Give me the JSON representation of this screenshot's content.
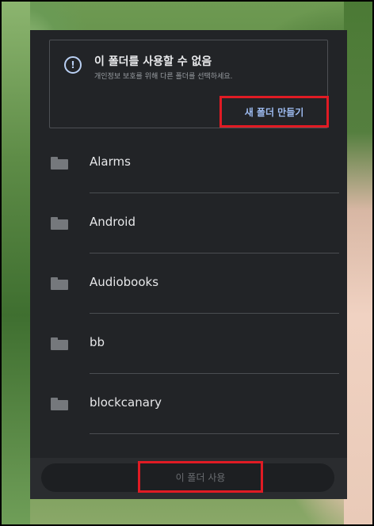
{
  "dialog": {
    "warning": {
      "icon": "info-icon",
      "title": "이 폴더를 사용할 수 없음",
      "subtitle": "개인정보 보호를 위해 다른 폴더를 선택하세요."
    },
    "new_folder_label": "새 폴더 만들기",
    "folders": [
      {
        "name": "Alarms"
      },
      {
        "name": "Android"
      },
      {
        "name": "Audiobooks"
      },
      {
        "name": "bb"
      },
      {
        "name": "blockcanary"
      }
    ],
    "use_folder_label": "이 폴더 사용"
  },
  "colors": {
    "background": "#222427",
    "accent": "#9dbbf0",
    "highlight": "#e01b24"
  }
}
